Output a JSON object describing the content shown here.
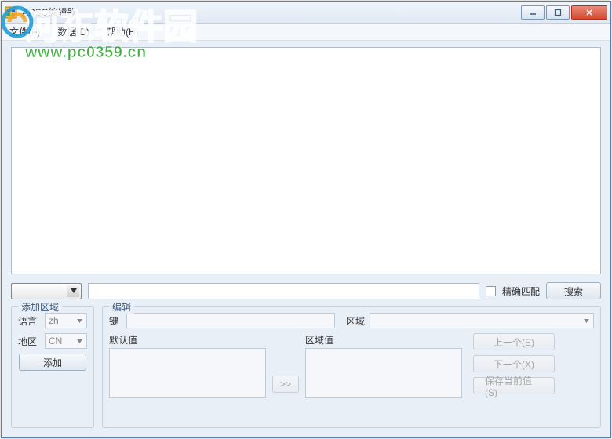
{
  "window": {
    "title": "ARSC编辑器"
  },
  "menu": {
    "file": "文件(F)",
    "data": "数据(D)",
    "help": "帮助(H)"
  },
  "search": {
    "exact_match_label": "精确匹配",
    "search_button": "搜索"
  },
  "add_region": {
    "group_title": "添加区域",
    "language_label": "语言",
    "language_value": "zh",
    "region_label": "地区",
    "region_value": "CN",
    "add_button": "添加"
  },
  "edit": {
    "group_title": "编辑",
    "key_label": "键",
    "region_label": "区域",
    "default_value_label": "默认值",
    "region_value_label": "区域值",
    "copy_button": ">>",
    "prev_button": "上一个(E)",
    "next_button": "下一个(X)",
    "save_button": "保存当前值(S)"
  },
  "watermark": {
    "site_name": "河东软件园",
    "url": "www.pc0359.cn"
  }
}
